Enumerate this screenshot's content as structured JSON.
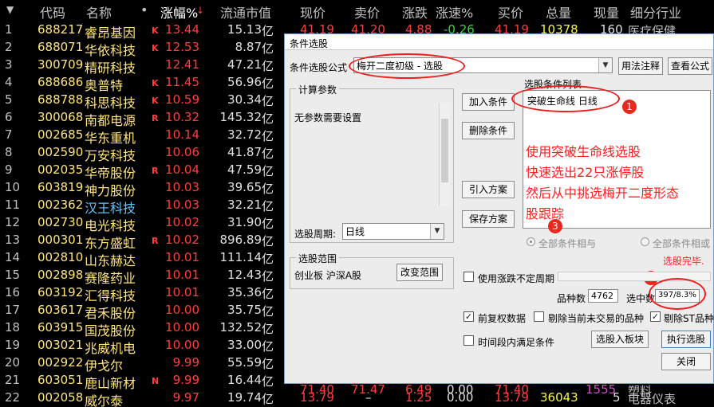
{
  "header": {
    "sort_icon": "▼",
    "code": "代码",
    "name": "名称",
    "dot": "•",
    "change": "涨幅%",
    "sort_arrow": "↓",
    "market_cap": "流通市值",
    "price": "现价",
    "ask": "卖价",
    "updown": "涨跌",
    "speed": "涨速%",
    "bid": "买价",
    "volume": "总量",
    "now_vol": "现量",
    "industry": "细分行业"
  },
  "unit": "亿",
  "rows": [
    {
      "no": "1",
      "code": "688217",
      "name": "睿昂基因",
      "flag": "K",
      "change": "13.44",
      "cap": "15.13"
    },
    {
      "no": "2",
      "code": "688071",
      "name": "华依科技",
      "flag": "K",
      "change": "12.53",
      "cap": "8.87"
    },
    {
      "no": "3",
      "code": "300709",
      "name": "精研科技",
      "flag": "",
      "change": "12.41",
      "cap": "47.21"
    },
    {
      "no": "4",
      "code": "688686",
      "name": "奥普特",
      "flag": "K",
      "change": "11.45",
      "cap": "56.96"
    },
    {
      "no": "5",
      "code": "688788",
      "name": "科思科技",
      "flag": "K",
      "change": "10.59",
      "cap": "30.34"
    },
    {
      "no": "6",
      "code": "300068",
      "name": "南都电源",
      "flag": "R",
      "change": "10.32",
      "cap": "145.32"
    },
    {
      "no": "7",
      "code": "002685",
      "name": "华东重机",
      "flag": "",
      "change": "10.14",
      "cap": "32.72"
    },
    {
      "no": "8",
      "code": "002590",
      "name": "万安科技",
      "flag": "",
      "change": "10.06",
      "cap": "41.87"
    },
    {
      "no": "9",
      "code": "002035",
      "name": "华帝股份",
      "flag": "R",
      "change": "10.04",
      "cap": "47.59"
    },
    {
      "no": "10",
      "code": "603819",
      "name": "神力股份",
      "flag": "",
      "change": "10.03",
      "cap": "39.65"
    },
    {
      "no": "11",
      "code": "002362",
      "name": "汉王科技",
      "flag": "",
      "change": "10.03",
      "cap": "32.21",
      "name_color": "#5ac8ff"
    },
    {
      "no": "12",
      "code": "002730",
      "name": "电光科技",
      "flag": "",
      "change": "10.02",
      "cap": "31.90"
    },
    {
      "no": "13",
      "code": "000301",
      "name": "东方盛虹",
      "flag": "R",
      "change": "10.02",
      "cap": "896.89"
    },
    {
      "no": "14",
      "code": "002810",
      "name": "山东赫达",
      "flag": "",
      "change": "10.01",
      "cap": "111.14"
    },
    {
      "no": "15",
      "code": "002898",
      "name": "赛隆药业",
      "flag": "",
      "change": "10.01",
      "cap": "12.43"
    },
    {
      "no": "16",
      "code": "603192",
      "name": "汇得科技",
      "flag": "",
      "change": "10.01",
      "cap": "35.36"
    },
    {
      "no": "17",
      "code": "603617",
      "name": "君禾股份",
      "flag": "",
      "change": "10.00",
      "cap": "35.75"
    },
    {
      "no": "18",
      "code": "603915",
      "name": "国茂股份",
      "flag": "",
      "change": "10.00",
      "cap": "132.52"
    },
    {
      "no": "19",
      "code": "003021",
      "name": "兆威机电",
      "flag": "",
      "change": "10.00",
      "cap": "33.00"
    },
    {
      "no": "20",
      "code": "002922",
      "name": "伊戈尔",
      "flag": "",
      "change": "9.99",
      "cap": "55.59"
    },
    {
      "no": "21",
      "code": "603051",
      "name": "鹿山新材",
      "flag": "N",
      "change": "9.99",
      "cap": "16.44"
    },
    {
      "no": "22",
      "code": "002058",
      "name": "威尔泰",
      "flag": "",
      "change": "9.97",
      "cap": "19.74"
    }
  ],
  "row1_tail": {
    "price": "41.19",
    "ask": "41.20",
    "updown": "4.88",
    "speed": "-0.26",
    "bid": "41.19",
    "volume": "10378",
    "now_vol": "160",
    "industry": "医疗保健"
  },
  "row21_tail": {
    "price": "71.40",
    "ask": "71.47",
    "updown": "6.49",
    "speed": "0.00",
    "bid": "71.40",
    "volume": "1555",
    "industry": "塑料"
  },
  "row22_tail": {
    "price": "13.79",
    "ask": "–",
    "updown": "1.25",
    "speed": "0.00",
    "bid": "13.79",
    "volume": "36043",
    "now_vol": "5",
    "industry": "电器仪表"
  },
  "dialog": {
    "title": "条件选股",
    "formula_label": "条件选股公式",
    "formula_value": "梅开二度初级 - 选股",
    "usage_btn": "用法注释",
    "view_btn": "查看公式",
    "params_title": "计算参数",
    "params_text": "无参数需要设置",
    "period_label": "选股周期:",
    "period_value": "日线",
    "range_title": "选股范围",
    "range_text": "创业板 沪深A股",
    "change_range_btn": "改变范围",
    "add_btn": "加入条件",
    "delete_btn": "删除条件",
    "import_btn": "引入方案",
    "save_btn": "保存方案",
    "list_title": "选股条件列表",
    "list_item": "突破生命线 日线",
    "annotation_lines": [
      "使用突破生命线选股",
      "快速选出22只涨停股",
      "然后从中挑选梅开二度形态",
      "股跟踪"
    ],
    "radio_all_and": "全部条件相与",
    "radio_all_or": "全部条件相或",
    "done_text": "选股完毕.",
    "use_period_label": "使用涨跌不定周期",
    "variety_label": "品种数",
    "variety_value": "4762",
    "selected_label": "选中数",
    "selected_value": "397/8.3%",
    "fq_label": "前复权数据",
    "exclude_untraded_label": "剔除当前未交易的品种",
    "exclude_st_label": "剔除ST品种",
    "timespan_label": "时间段内满足条件",
    "to_block_btn": "选股入板块",
    "run_btn": "执行选股",
    "close_btn": "关闭",
    "badges": [
      "1",
      "2",
      "3"
    ]
  },
  "colors": {
    "up_red": "#ff3d3d",
    "code_yellow": "#ffe57a",
    "volume_yellow": "#f7f740",
    "annotation_red": "#ff2020",
    "highlight_blue": "#5ac8ff"
  }
}
